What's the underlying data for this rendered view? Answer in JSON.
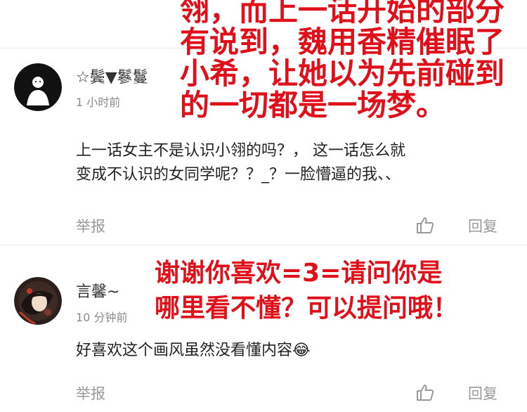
{
  "comments": [
    {
      "username": "☆鬓▼鬖鬘",
      "time": "1 小时前",
      "text_line1": "上一话女主不是认识小翎的吗？，  这一话怎么就",
      "text_line2": "变成不认识的女同学呢？？_？一脸懵逼的我、、",
      "report_label": "举报",
      "reply_label": "回复",
      "like_icon": "thumbs-up-icon"
    },
    {
      "username": "言馨~",
      "time": "10 分钟前",
      "text": "好喜欢这个画风虽然没看懂内容",
      "emoji": "😂",
      "report_label": "举报",
      "reply_label": "回复",
      "like_icon": "thumbs-up-icon"
    }
  ],
  "annotations": {
    "first": [
      "翎，而上一话开始的部分",
      "有说到，魏用香精催眠了",
      "小希，让她以为先前碰到",
      "的一切都是一场梦。"
    ],
    "second": [
      "谢谢你喜欢=3=请问你是",
      "哪里看不懂？可以提问哦！"
    ]
  },
  "colors": {
    "annotation": "#e0101a",
    "muted": "#9a9a9a"
  }
}
